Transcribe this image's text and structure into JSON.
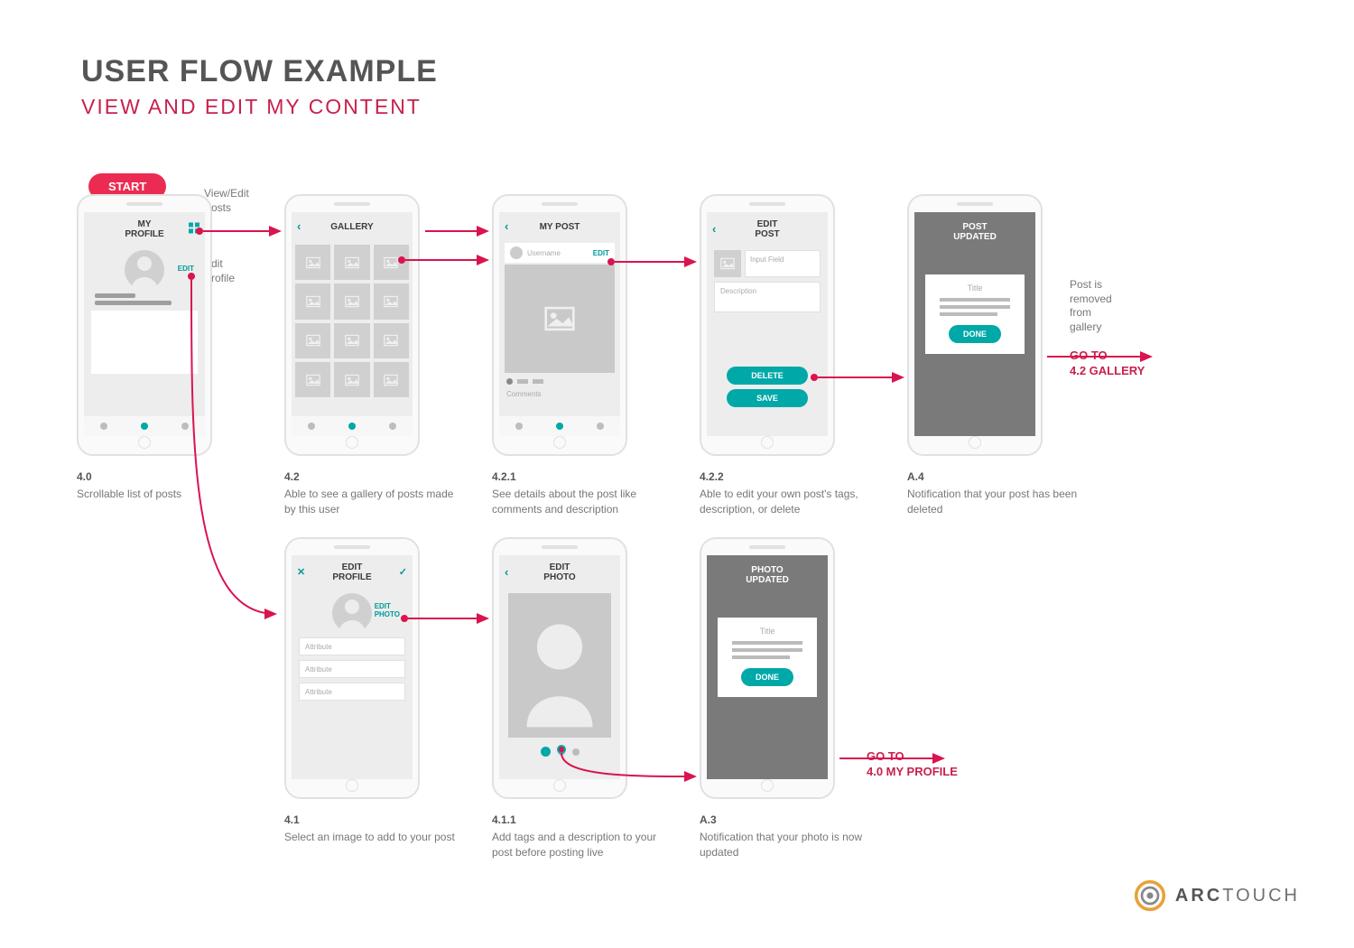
{
  "header": {
    "title": "USER FLOW EXAMPLE",
    "subtitle": "VIEW AND EDIT MY CONTENT"
  },
  "start_label": "START",
  "annotations": {
    "view_edit_posts": "View/Edit\nPosts",
    "edit_profile": "Edit\nProfile"
  },
  "gotos": {
    "gallery": "GO TO\n4.2 GALLERY",
    "gallery_note": "Post is\nremoved\nfrom\ngallery",
    "profile": "GO TO\n4.0 MY PROFILE"
  },
  "screens": {
    "s40": {
      "id": "4.0",
      "desc": "Scrollable list of posts",
      "title": "MY\nPROFILE",
      "edit": "EDIT"
    },
    "s42": {
      "id": "4.2",
      "desc": "Able to see a gallery of posts made by this user",
      "title": "GALLERY"
    },
    "s421": {
      "id": "4.2.1",
      "desc": "See details about the post like comments and description",
      "title": "MY POST",
      "user": "Username",
      "edit": "EDIT",
      "comments": "Comments"
    },
    "s422": {
      "id": "4.2.2",
      "desc": "Able to edit your own post's tags, description, or delete",
      "title": "EDIT\nPOST",
      "input": "Input Field",
      "descfield": "Description",
      "delete": "DELETE",
      "save": "SAVE"
    },
    "sA4": {
      "id": "A.4",
      "desc": "Notification that your post has been deleted",
      "title": "POST\nUPDATED",
      "card_title": "Title",
      "done": "DONE"
    },
    "s41": {
      "id": "4.1",
      "desc": "Select an image to add to your post",
      "title": "EDIT\nPROFILE",
      "editphoto": "EDIT\nPHOTO",
      "attr": "Attribute"
    },
    "s411": {
      "id": "4.1.1",
      "desc": "Add tags and a description to your post before posting live",
      "title": "EDIT\nPHOTO"
    },
    "sA3": {
      "id": "A.3",
      "desc": "Notification that your photo is now updated",
      "title": "PHOTO\nUPDATED",
      "card_title": "Title",
      "done": "DONE"
    }
  },
  "logo": {
    "brand_bold": "ARC",
    "brand_light": "TOUCH"
  }
}
